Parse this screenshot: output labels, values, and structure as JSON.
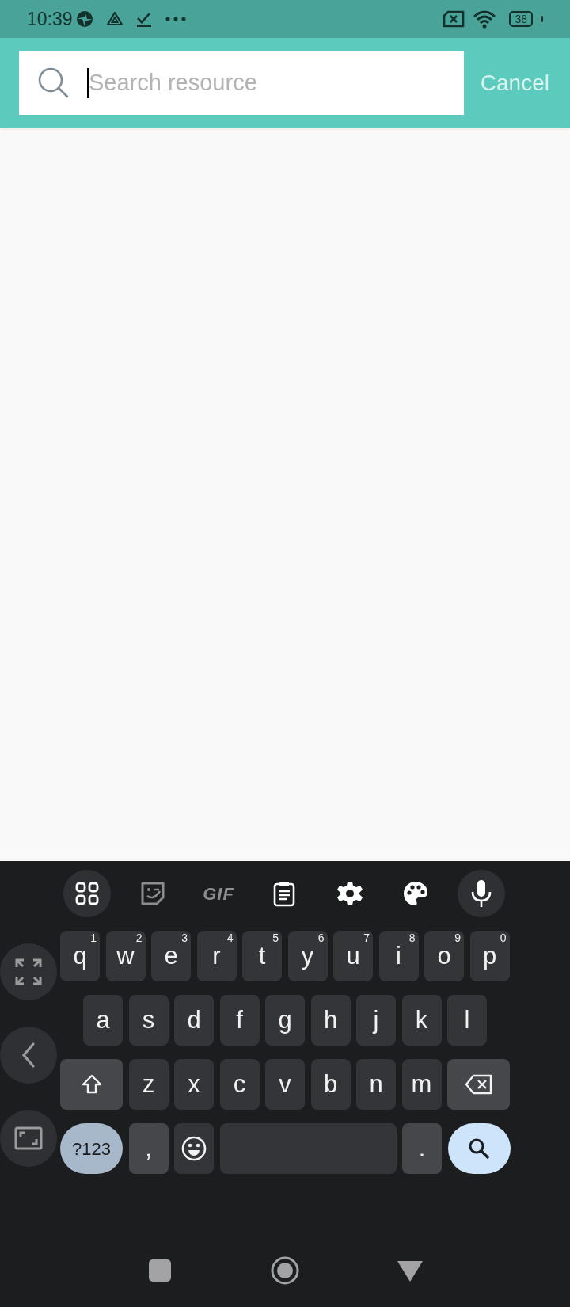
{
  "status_bar": {
    "time": "10:39",
    "battery": "38"
  },
  "search_bar": {
    "placeholder": "Search resource",
    "focused": true,
    "cancel": "Cancel"
  },
  "keyboard": {
    "toolbar": [
      {
        "kind": "apps"
      },
      {
        "kind": "sticker"
      },
      {
        "kind": "gif",
        "label": "GIF"
      },
      {
        "kind": "clipboard"
      },
      {
        "kind": "settings"
      },
      {
        "kind": "theme"
      },
      {
        "kind": "mic"
      }
    ],
    "side_buttons": [
      {
        "kind": "expand"
      },
      {
        "kind": "back"
      },
      {
        "kind": "resize"
      }
    ],
    "rows": [
      {
        "keys": [
          {
            "kind": "letter",
            "label": "q",
            "hint": "1"
          },
          {
            "kind": "letter",
            "label": "w",
            "hint": "2"
          },
          {
            "kind": "letter",
            "label": "e",
            "hint": "3"
          },
          {
            "kind": "letter",
            "label": "r",
            "hint": "4"
          },
          {
            "kind": "letter",
            "label": "t",
            "hint": "5"
          },
          {
            "kind": "letter",
            "label": "y",
            "hint": "6"
          },
          {
            "kind": "letter",
            "label": "u",
            "hint": "7"
          },
          {
            "kind": "letter",
            "label": "i",
            "hint": "8"
          },
          {
            "kind": "letter",
            "label": "o",
            "hint": "9"
          },
          {
            "kind": "letter",
            "label": "p",
            "hint": "0"
          }
        ]
      },
      {
        "keys": [
          {
            "kind": "letter",
            "label": "a"
          },
          {
            "kind": "letter",
            "label": "s"
          },
          {
            "kind": "letter",
            "label": "d"
          },
          {
            "kind": "letter",
            "label": "f"
          },
          {
            "kind": "letter",
            "label": "g"
          },
          {
            "kind": "letter",
            "label": "h"
          },
          {
            "kind": "letter",
            "label": "j"
          },
          {
            "kind": "letter",
            "label": "k"
          },
          {
            "kind": "letter",
            "label": "l"
          }
        ]
      },
      {
        "keys": [
          {
            "kind": "shift"
          },
          {
            "kind": "letter",
            "label": "z"
          },
          {
            "kind": "letter",
            "label": "x"
          },
          {
            "kind": "letter",
            "label": "c"
          },
          {
            "kind": "letter",
            "label": "v"
          },
          {
            "kind": "letter",
            "label": "b"
          },
          {
            "kind": "letter",
            "label": "n"
          },
          {
            "kind": "letter",
            "label": "m"
          },
          {
            "kind": "backspace"
          }
        ]
      },
      {
        "keys": [
          {
            "kind": "symbols",
            "label": "?123"
          },
          {
            "kind": "punct",
            "label": ","
          },
          {
            "kind": "emoji"
          },
          {
            "kind": "space"
          },
          {
            "kind": "punct",
            "label": "."
          },
          {
            "kind": "search"
          }
        ]
      }
    ]
  },
  "nav_bar": [
    {
      "kind": "recents"
    },
    {
      "kind": "home"
    },
    {
      "kind": "back"
    }
  ]
}
